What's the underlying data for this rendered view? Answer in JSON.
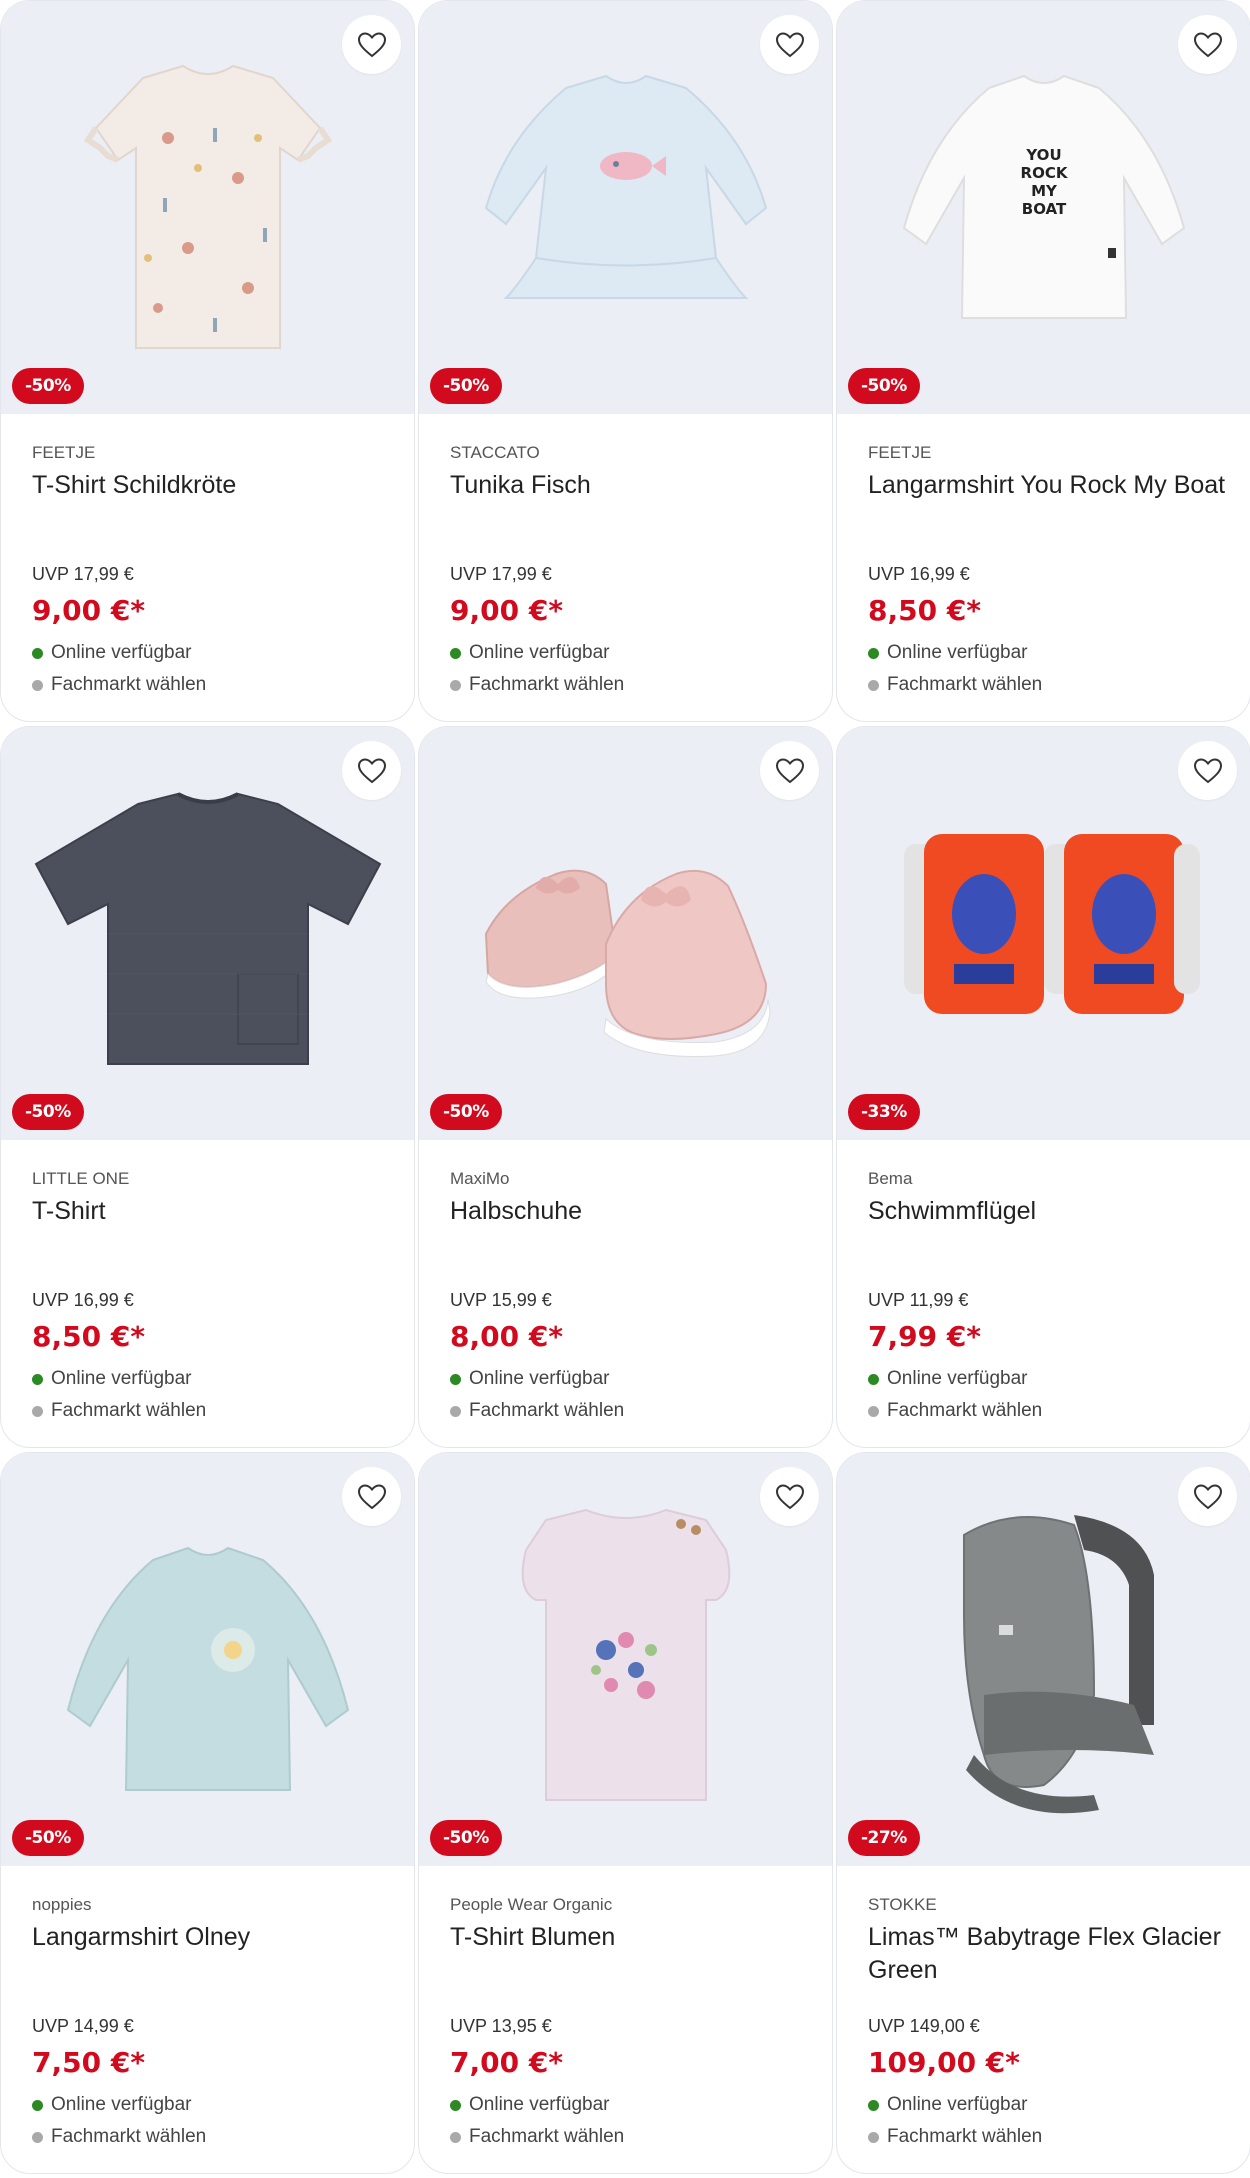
{
  "colors": {
    "sale_red": "#d20a1e",
    "available_green": "#2b8a22",
    "store_grey": "#a9a9a9",
    "image_bg": "#eceef5"
  },
  "icons": {
    "wishlist": "heart-outline-icon"
  },
  "products": [
    {
      "brand": "FEETJE",
      "title": "T-Shirt Schildkröte",
      "discount": "-50%",
      "uvp": "UVP 17,99 €",
      "price": "9,00 €*",
      "online": "Online verfügbar",
      "store": "Fachmarkt wählen",
      "image": "cream-tshirt"
    },
    {
      "brand": "STACCATO",
      "title": "Tunika Fisch",
      "discount": "-50%",
      "uvp": "UVP 17,99 €",
      "price": "9,00 €*",
      "online": "Online verfügbar",
      "store": "Fachmarkt wählen",
      "image": "lightblue-tunic"
    },
    {
      "brand": "FEETJE",
      "title": "Langarmshirt You Rock My Boat",
      "discount": "-50%",
      "uvp": "UVP 16,99 €",
      "price": "8,50 €*",
      "online": "Online verfügbar",
      "store": "Fachmarkt wählen",
      "image": "white-longsleeve"
    },
    {
      "brand": "LITTLE ONE",
      "title": "T-Shirt",
      "discount": "-50%",
      "uvp": "UVP 16,99 €",
      "price": "8,50 €*",
      "online": "Online verfügbar",
      "store": "Fachmarkt wählen",
      "image": "grey-tshirt"
    },
    {
      "brand": "MaxiMo",
      "title": "Halbschuhe",
      "discount": "-50%",
      "uvp": "UVP 15,99 €",
      "price": "8,00 €*",
      "online": "Online verfügbar",
      "store": "Fachmarkt wählen",
      "image": "pink-shoes"
    },
    {
      "brand": "Bema",
      "title": "Schwimmflügel",
      "discount": "-33%",
      "uvp": "UVP 11,99 €",
      "price": "7,99 €*",
      "online": "Online verfügbar",
      "store": "Fachmarkt wählen",
      "image": "armbands"
    },
    {
      "brand": "noppies",
      "title": "Langarmshirt Olney",
      "discount": "-50%",
      "uvp": "UVP 14,99 €",
      "price": "7,50 €*",
      "online": "Online verfügbar",
      "store": "Fachmarkt wählen",
      "image": "mint-longsleeve"
    },
    {
      "brand": "People Wear Organic",
      "title": "T-Shirt Blumen",
      "discount": "-50%",
      "uvp": "UVP 13,95 €",
      "price": "7,00 €*",
      "online": "Online verfügbar",
      "store": "Fachmarkt wählen",
      "image": "lilac-tshirt"
    },
    {
      "brand": "STOKKE",
      "title": "Limas™ Babytrage Flex Glacier Green",
      "discount": "-27%",
      "uvp": "UVP 149,00 €",
      "price": "109,00 €*",
      "online": "Online verfügbar",
      "store": "Fachmarkt wählen",
      "image": "baby-carrier"
    }
  ]
}
